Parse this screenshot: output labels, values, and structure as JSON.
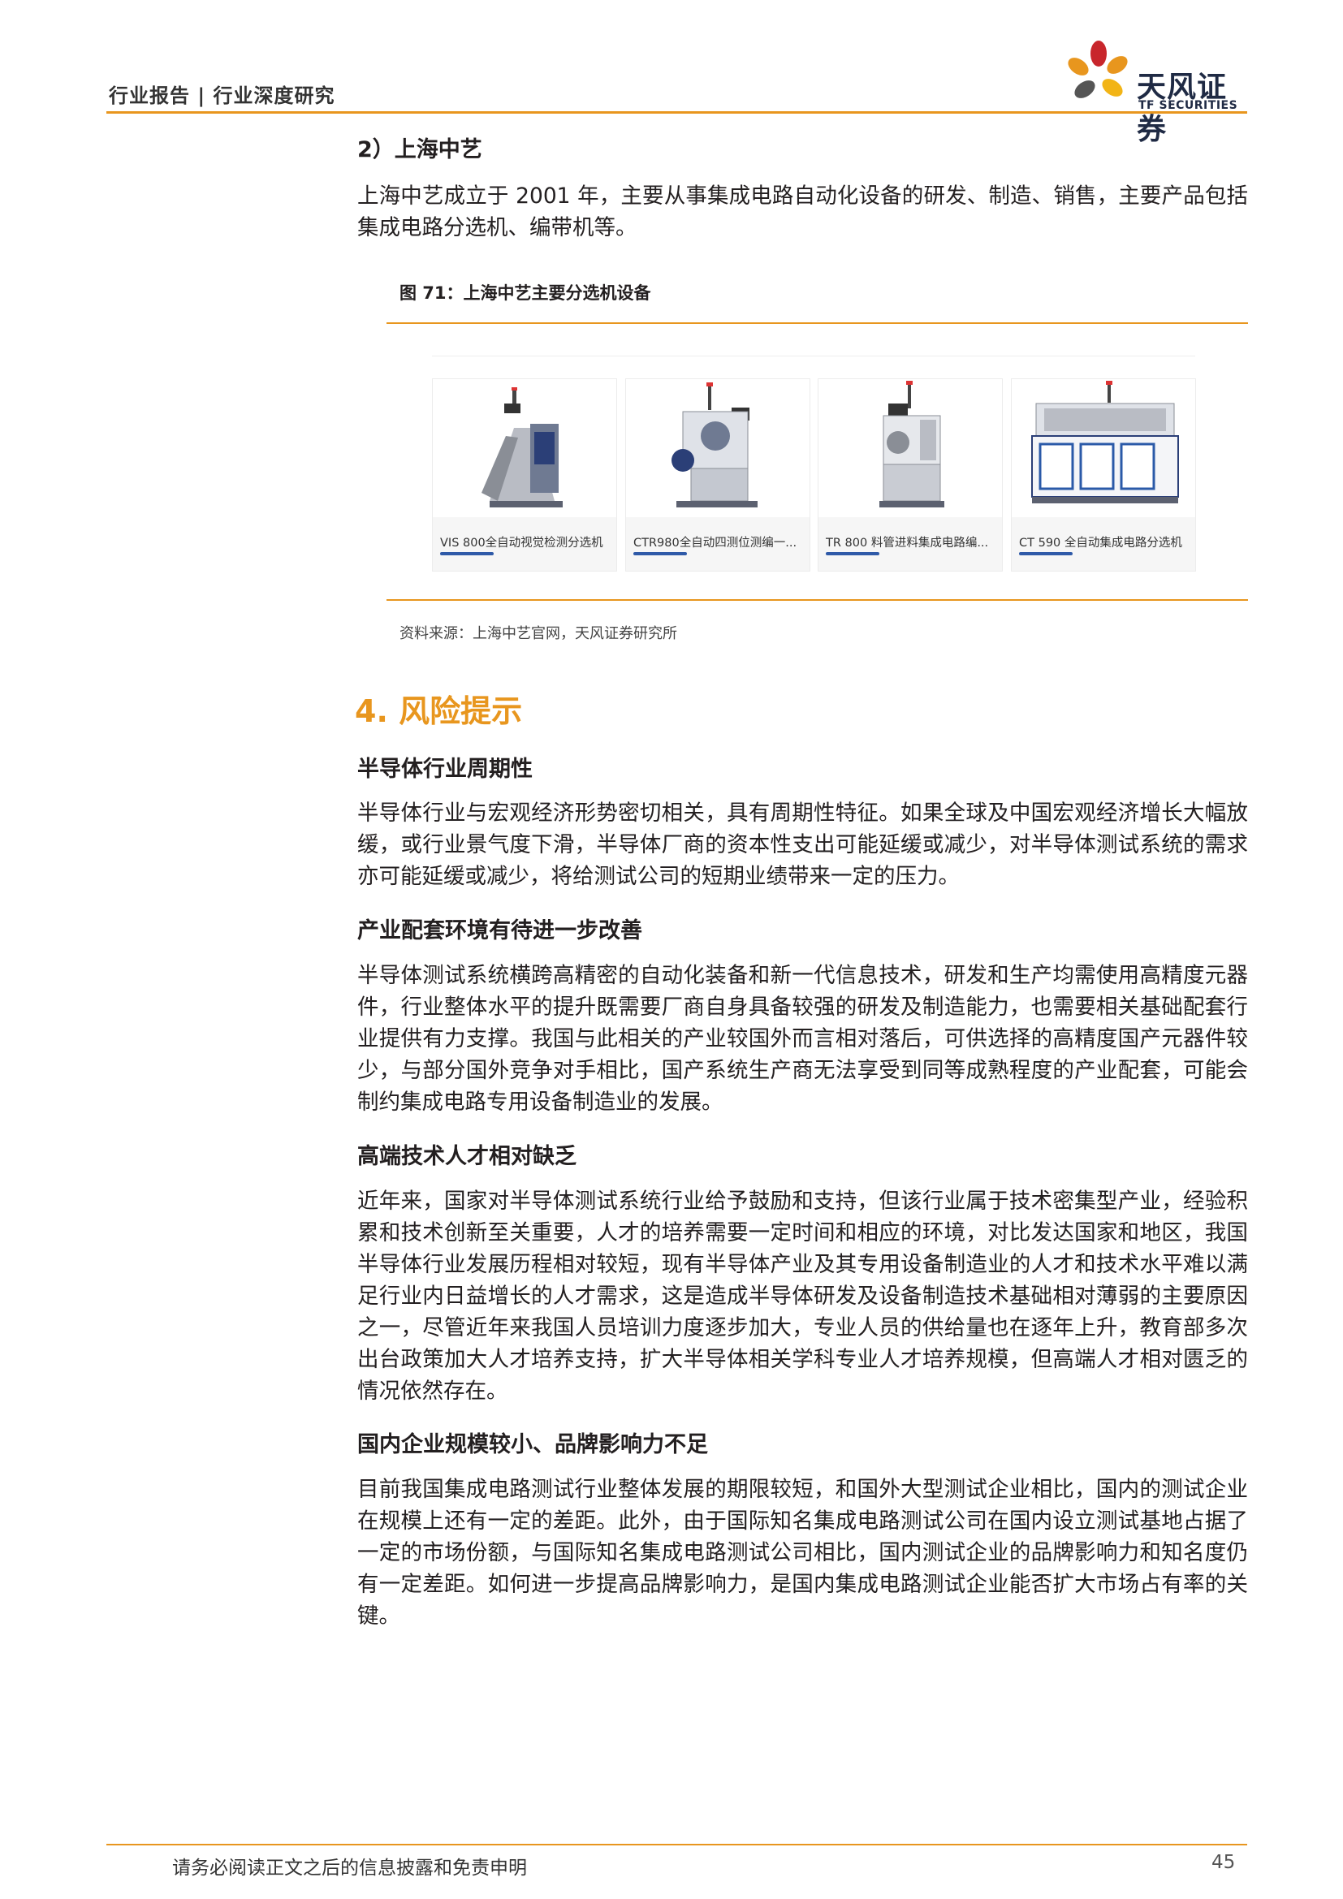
{
  "header": {
    "breadcrumb": "行业报告 | 行业深度研究",
    "logo_name": "天风证券",
    "logo_sub": "TF SECURITIES",
    "accent_color": "#e8961e"
  },
  "company_section": {
    "heading": "2）上海中艺",
    "paragraph": "上海中艺成立于 2001 年，主要从事集成电路自动化设备的研发、制造、销售，主要产品包括集成电路分选机、编带机等。"
  },
  "figure": {
    "title": "图 71：上海中艺主要分选机设备",
    "products": [
      {
        "label": "VIS 800全自动视觉检测分选机"
      },
      {
        "label": "CTR980全自动四测位测编一..."
      },
      {
        "label": "TR 800 料管进料集成电路编..."
      },
      {
        "label": "CT 590 全自动集成电路分选机"
      }
    ],
    "source": "资料来源：上海中艺官网，天风证券研究所"
  },
  "risk_section": {
    "title": "4. 风险提示",
    "items": [
      {
        "heading": "半导体行业周期性",
        "text": "半导体行业与宏观经济形势密切相关，具有周期性特征。如果全球及中国宏观经济增长大幅放缓，或行业景气度下滑，半导体厂商的资本性支出可能延缓或减少，对半导体测试系统的需求亦可能延缓或减少，将给测试公司的短期业绩带来一定的压力。"
      },
      {
        "heading": "产业配套环境有待进一步改善",
        "text": "半导体测试系统横跨高精密的自动化装备和新一代信息技术，研发和生产均需使用高精度元器件，行业整体水平的提升既需要厂商自身具备较强的研发及制造能力，也需要相关基础配套行业提供有力支撑。我国与此相关的产业较国外而言相对落后，可供选择的高精度国产元器件较少，与部分国外竞争对手相比，国产系统生产商无法享受到同等成熟程度的产业配套，可能会制约集成电路专用设备制造业的发展。"
      },
      {
        "heading": "高端技术人才相对缺乏",
        "text": "近年来，国家对半导体测试系统行业给予鼓励和支持，但该行业属于技术密集型产业，经验积累和技术创新至关重要，人才的培养需要一定时间和相应的环境，对比发达国家和地区，我国半导体行业发展历程相对较短，现有半导体产业及其专用设备制造业的人才和技术水平难以满足行业内日益增长的人才需求，这是造成半导体研发及设备制造技术基础相对薄弱的主要原因之一，尽管近年来我国人员培训力度逐步加大，专业人员的供给量也在逐年上升，教育部多次出台政策加大人才培养支持，扩大半导体相关学科专业人才培养规模，但高端人才相对匮乏的情况依然存在。"
      },
      {
        "heading": "国内企业规模较小、品牌影响力不足",
        "text": "目前我国集成电路测试行业整体发展的期限较短，和国外大型测试企业相比，国内的测试企业在规模上还有一定的差距。此外，由于国际知名集成电路测试公司在国内设立测试基地占据了一定的市场份额，与国际知名集成电路测试公司相比，国内测试企业的品牌影响力和知名度仍有一定差距。如何进一步提高品牌影响力，是国内集成电路测试企业能否扩大市场占有率的关键。"
      }
    ]
  },
  "footer": {
    "disclaimer": "请务必阅读正文之后的信息披露和免责申明",
    "page_number": "45"
  }
}
